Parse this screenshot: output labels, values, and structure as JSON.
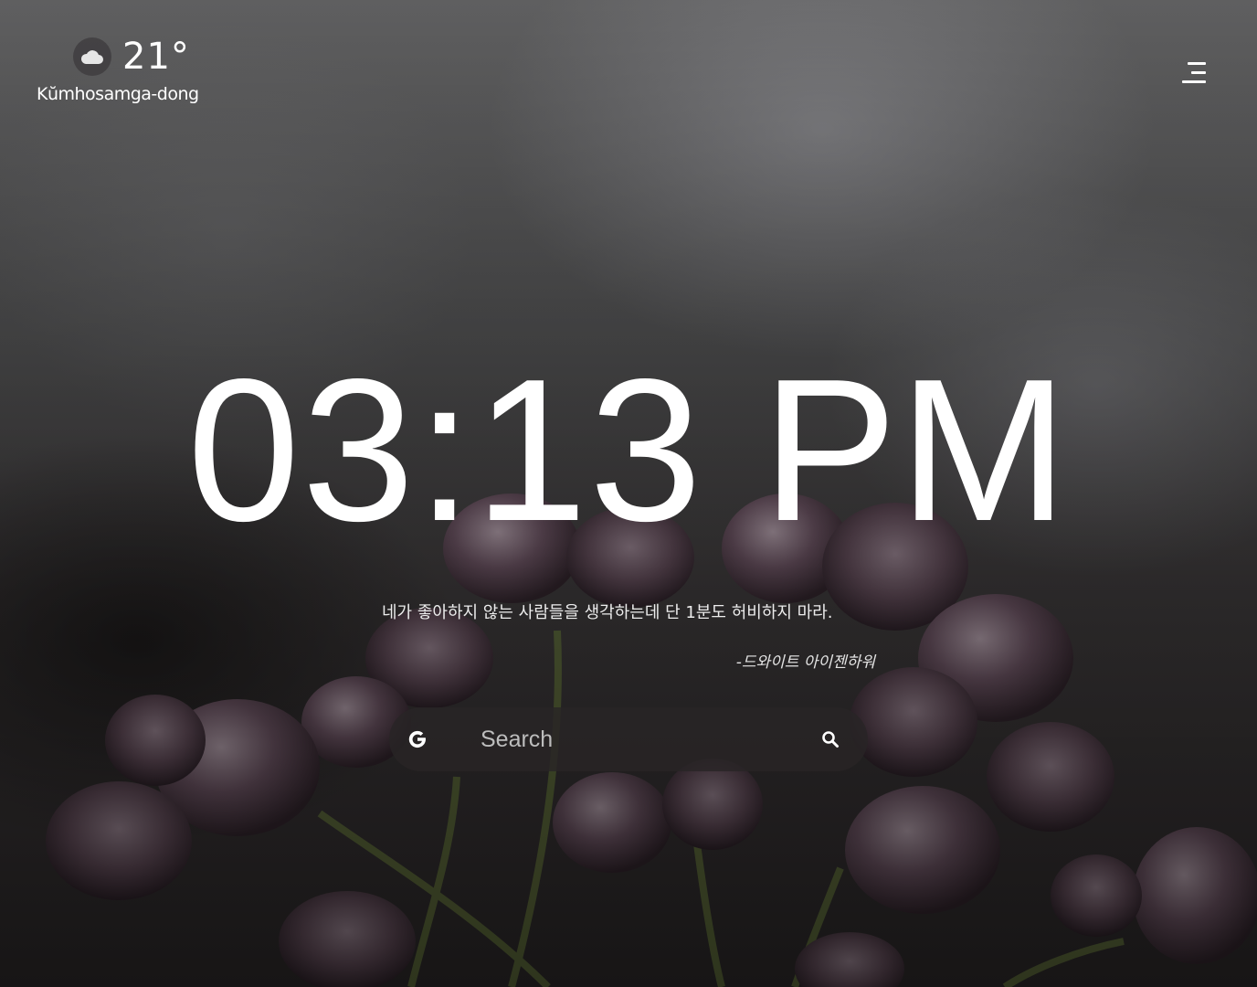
{
  "weather": {
    "icon": "cloud-icon",
    "temperature": "21°",
    "location": "Kŭmhosamga-dong"
  },
  "menu": {
    "icon": "menu-icon"
  },
  "clock": {
    "time": "03:13 PM"
  },
  "quote": {
    "text": "네가 좋아하지 않는 사람들을 생각하는데 단 1분도 허비하지 마라.",
    "author": "-드와이트 아이젠하워"
  },
  "search": {
    "engine_icon": "google-g-icon",
    "placeholder": "Search",
    "value": "",
    "button_icon": "search-icon"
  }
}
